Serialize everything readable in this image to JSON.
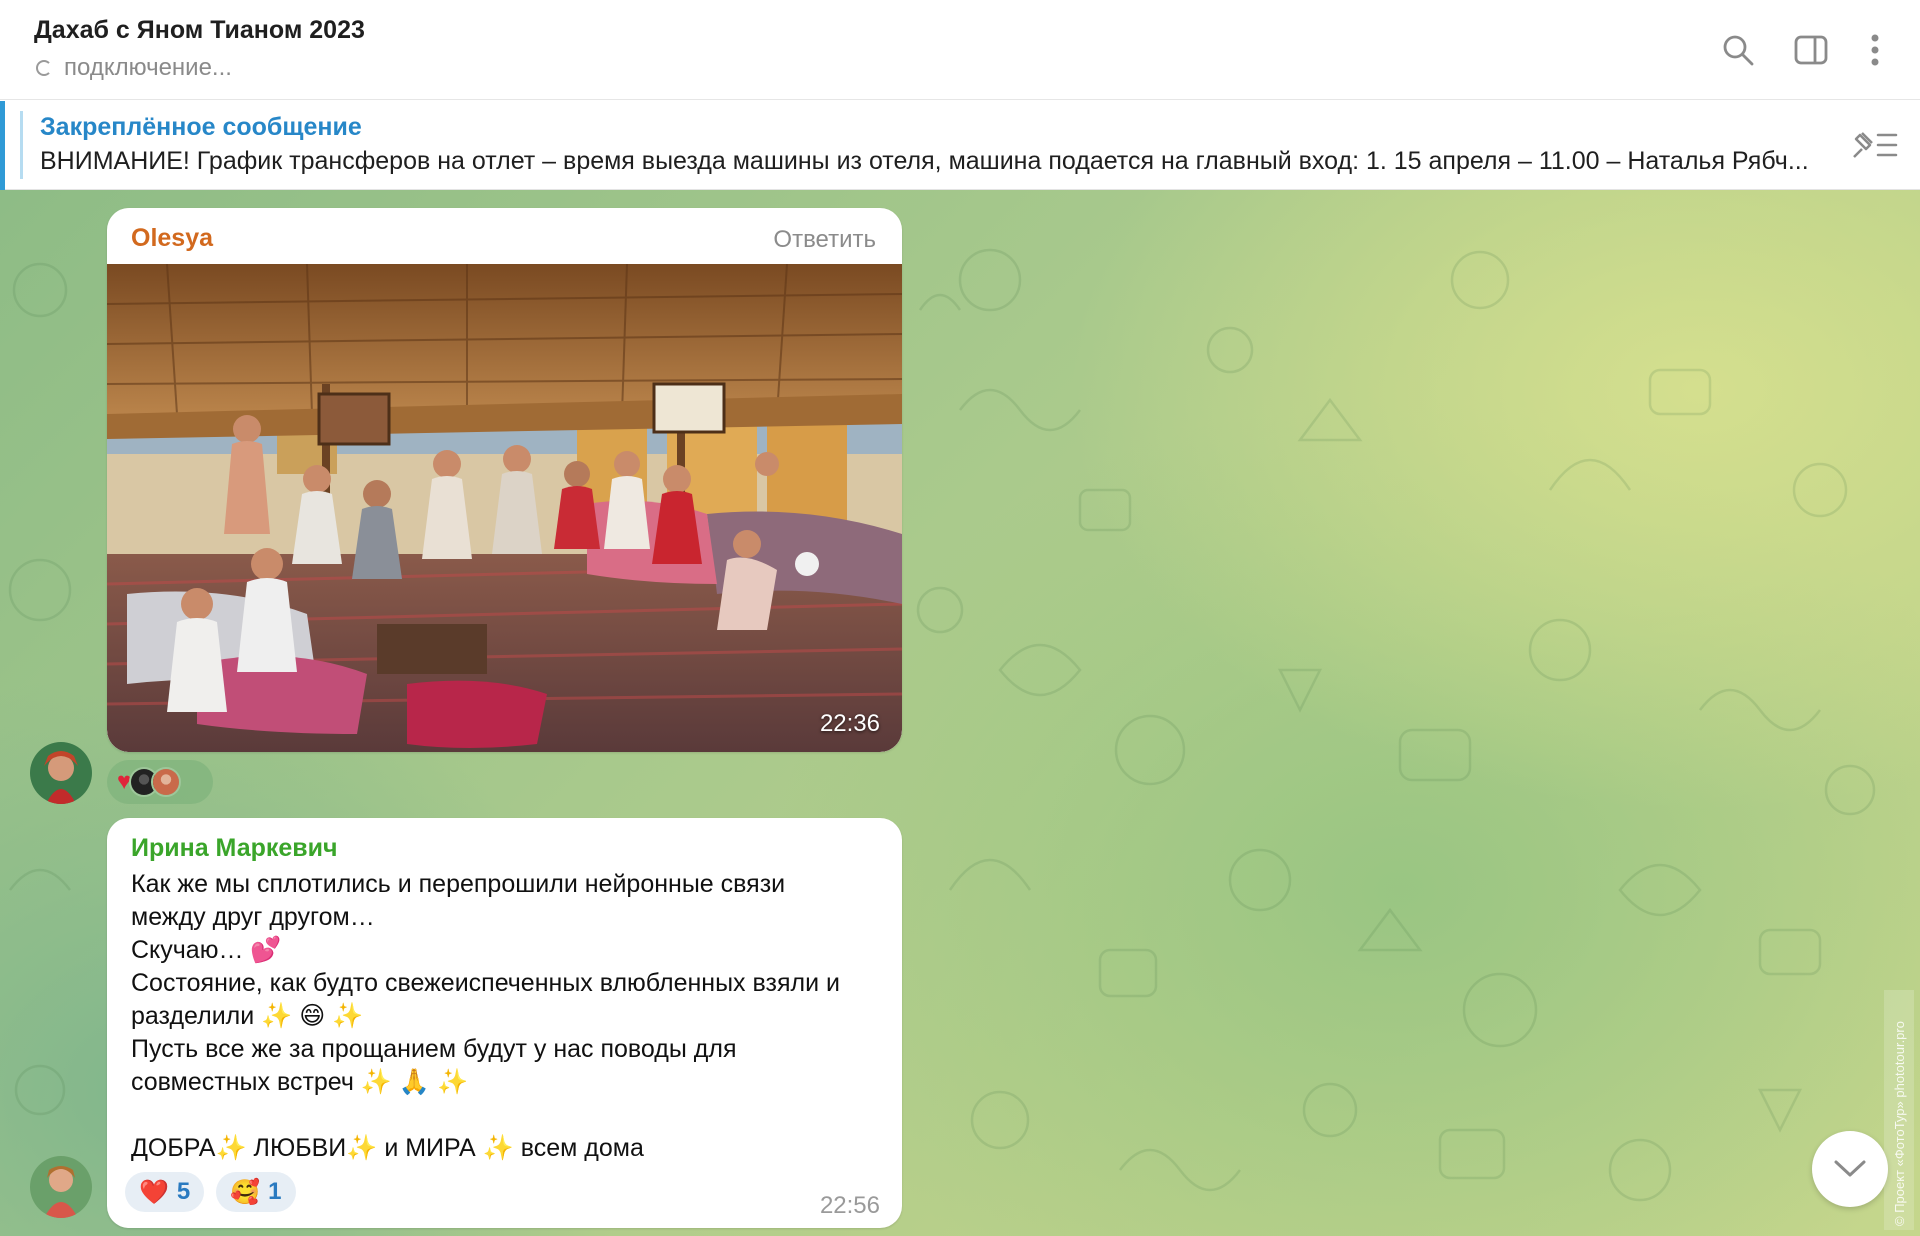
{
  "header": {
    "title": "Дахаб с Яном Тианом 2023",
    "status": "подключение..."
  },
  "pinned": {
    "title": "Закреплённое сообщение",
    "text": "ВНИМАНИЕ! График трансферов на отлет – время выезда машины из отеля, машина подается на главный вход:  1. 15 апреля – 11.00  – Наталья Рябч..."
  },
  "messages": [
    {
      "sender": "Olesya",
      "reply_label": "Ответить",
      "time": "22:36",
      "reactions_strip": {
        "emoji": "heart"
      }
    },
    {
      "sender": "Ирина Маркевич",
      "lines": [
        "Как же мы сплотились и перепрошили нейронные связи",
        "между друг другом…",
        "Скучаю… 💕",
        "Состояние, как будто свежеиспеченных влюбленных взяли и",
        "разделили ✨ 😄 ✨",
        "Пусть все же за прощанием будут у нас поводы для",
        "совместных встреч ✨ 🙏 ✨",
        "",
        "ДОБРА✨ ЛЮБВИ✨ и МИРА ✨  всем дома"
      ],
      "reactions": [
        {
          "emoji": "❤️",
          "count": "5"
        },
        {
          "emoji": "🥰",
          "count": "1"
        }
      ],
      "time": "22:56"
    }
  ],
  "watermark": "© Проект «ФотоТур» phototour.pro",
  "colors": {
    "accent_blue": "#2f9ad6",
    "sender_olesya": "#d2691e",
    "sender_irina": "#3aa52a"
  },
  "icons": [
    "search-icon",
    "sidebar-toggle-icon",
    "more-vertical-icon",
    "pin-list-icon",
    "chevron-down-icon"
  ]
}
